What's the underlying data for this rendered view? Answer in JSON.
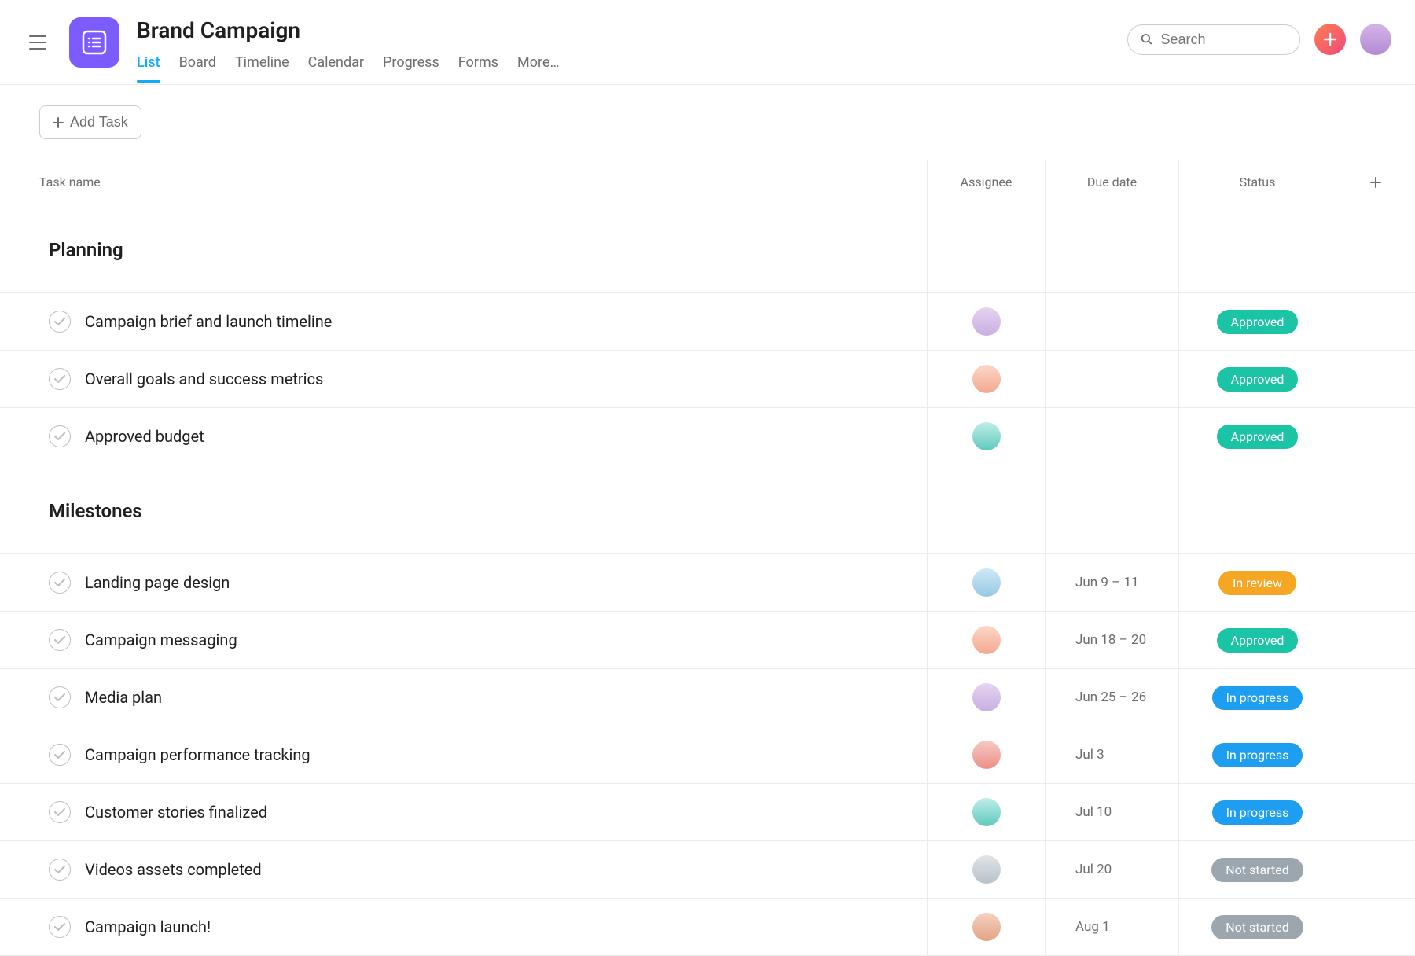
{
  "project": {
    "title": "Brand Campaign",
    "icon": "list-icon"
  },
  "tabs": [
    {
      "label": "List",
      "active": true
    },
    {
      "label": "Board",
      "active": false
    },
    {
      "label": "Timeline",
      "active": false
    },
    {
      "label": "Calendar",
      "active": false
    },
    {
      "label": "Progress",
      "active": false
    },
    {
      "label": "Forms",
      "active": false
    },
    {
      "label": "More…",
      "active": false
    }
  ],
  "search": {
    "placeholder": "Search"
  },
  "toolbar": {
    "add_task_label": "Add Task"
  },
  "columns": {
    "name": "Task name",
    "assignee": "Assignee",
    "due": "Due date",
    "status": "Status"
  },
  "status_labels": {
    "approved": "Approved",
    "in_review": "In review",
    "in_progress": "In progress",
    "not_started": "Not started"
  },
  "status_colors": {
    "approved": "#1bc4a4",
    "in_review": "#f5a623",
    "in_progress": "#1e9ef0",
    "not_started": "#9ca6af"
  },
  "sections": [
    {
      "title": "Planning",
      "tasks": [
        {
          "name": "Campaign brief and launch timeline",
          "assignee_avatar": "av1",
          "due": "",
          "status": "approved"
        },
        {
          "name": "Overall goals and success metrics",
          "assignee_avatar": "av2",
          "due": "",
          "status": "approved"
        },
        {
          "name": "Approved budget",
          "assignee_avatar": "av3",
          "due": "",
          "status": "approved"
        }
      ]
    },
    {
      "title": "Milestones",
      "tasks": [
        {
          "name": "Landing page design",
          "assignee_avatar": "av4",
          "due": "Jun 9 – 11",
          "status": "in_review"
        },
        {
          "name": "Campaign messaging",
          "assignee_avatar": "av2",
          "due": "Jun 18 – 20",
          "status": "approved"
        },
        {
          "name": "Media plan",
          "assignee_avatar": "av1",
          "due": "Jun 25 – 26",
          "status": "in_progress"
        },
        {
          "name": "Campaign performance tracking",
          "assignee_avatar": "av5",
          "due": "Jul 3",
          "status": "in_progress"
        },
        {
          "name": "Customer stories finalized",
          "assignee_avatar": "av3",
          "due": "Jul 10",
          "status": "in_progress"
        },
        {
          "name": "Videos assets completed",
          "assignee_avatar": "av6",
          "due": "Jul 20",
          "status": "not_started"
        },
        {
          "name": "Campaign launch!",
          "assignee_avatar": "av7",
          "due": "Aug 1",
          "status": "not_started"
        }
      ]
    }
  ]
}
